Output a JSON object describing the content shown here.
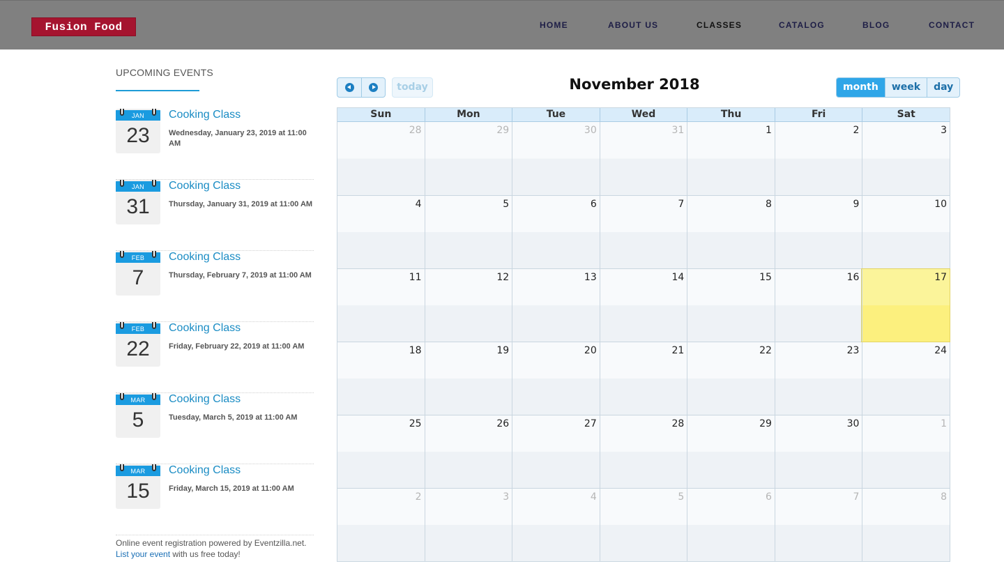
{
  "header": {
    "logo": "Fusion Food",
    "nav": [
      {
        "label": "HOME"
      },
      {
        "label": "ABOUT US"
      },
      {
        "label": "CLASSES"
      },
      {
        "label": "CATALOG"
      },
      {
        "label": "BLOG"
      },
      {
        "label": "CONTACT"
      }
    ]
  },
  "sidebar": {
    "title": "UPCOMING EVENTS",
    "events": [
      {
        "month": "JAN",
        "day": "23",
        "title": "Cooking Class",
        "date": "Wednesday, January 23, 2019 at 11:00 AM"
      },
      {
        "month": "JAN",
        "day": "31",
        "title": "Cooking Class",
        "date": "Thursday, January 31, 2019 at 11:00 AM"
      },
      {
        "month": "FEB",
        "day": "7",
        "title": "Cooking Class",
        "date": "Thursday, February 7, 2019 at 11:00 AM"
      },
      {
        "month": "FEB",
        "day": "22",
        "title": "Cooking Class",
        "date": "Friday, February 22, 2019 at 11:00 AM"
      },
      {
        "month": "MAR",
        "day": "5",
        "title": "Cooking Class",
        "date": "Tuesday, March 5, 2019 at 11:00 AM"
      },
      {
        "month": "MAR",
        "day": "15",
        "title": "Cooking Class",
        "date": "Friday, March 15, 2019 at 11:00 AM"
      }
    ],
    "footer": {
      "text1": "Online event registration powered by Eventzilla.net.",
      "link": "List your event",
      "text2": " with us free today!"
    }
  },
  "calendar": {
    "title": "November 2018",
    "today_label": "today",
    "views": [
      "month",
      "week",
      "day"
    ],
    "active_view": "month",
    "weekdays": [
      "Sun",
      "Mon",
      "Tue",
      "Wed",
      "Thu",
      "Fri",
      "Sat"
    ],
    "weeks": [
      [
        {
          "d": "28",
          "other": true
        },
        {
          "d": "29",
          "other": true
        },
        {
          "d": "30",
          "other": true
        },
        {
          "d": "31",
          "other": true
        },
        {
          "d": "1"
        },
        {
          "d": "2"
        },
        {
          "d": "3"
        }
      ],
      [
        {
          "d": "4"
        },
        {
          "d": "5"
        },
        {
          "d": "6"
        },
        {
          "d": "7"
        },
        {
          "d": "8"
        },
        {
          "d": "9"
        },
        {
          "d": "10"
        }
      ],
      [
        {
          "d": "11"
        },
        {
          "d": "12"
        },
        {
          "d": "13"
        },
        {
          "d": "14"
        },
        {
          "d": "15"
        },
        {
          "d": "16"
        },
        {
          "d": "17",
          "today": true
        }
      ],
      [
        {
          "d": "18"
        },
        {
          "d": "19"
        },
        {
          "d": "20"
        },
        {
          "d": "21"
        },
        {
          "d": "22"
        },
        {
          "d": "23"
        },
        {
          "d": "24"
        }
      ],
      [
        {
          "d": "25"
        },
        {
          "d": "26"
        },
        {
          "d": "27"
        },
        {
          "d": "28"
        },
        {
          "d": "29"
        },
        {
          "d": "30"
        },
        {
          "d": "1",
          "other": true
        }
      ],
      [
        {
          "d": "2",
          "other": true
        },
        {
          "d": "3",
          "other": true
        },
        {
          "d": "4",
          "other": true
        },
        {
          "d": "5",
          "other": true
        },
        {
          "d": "6",
          "other": true
        },
        {
          "d": "7",
          "other": true
        },
        {
          "d": "8",
          "other": true
        }
      ]
    ]
  }
}
